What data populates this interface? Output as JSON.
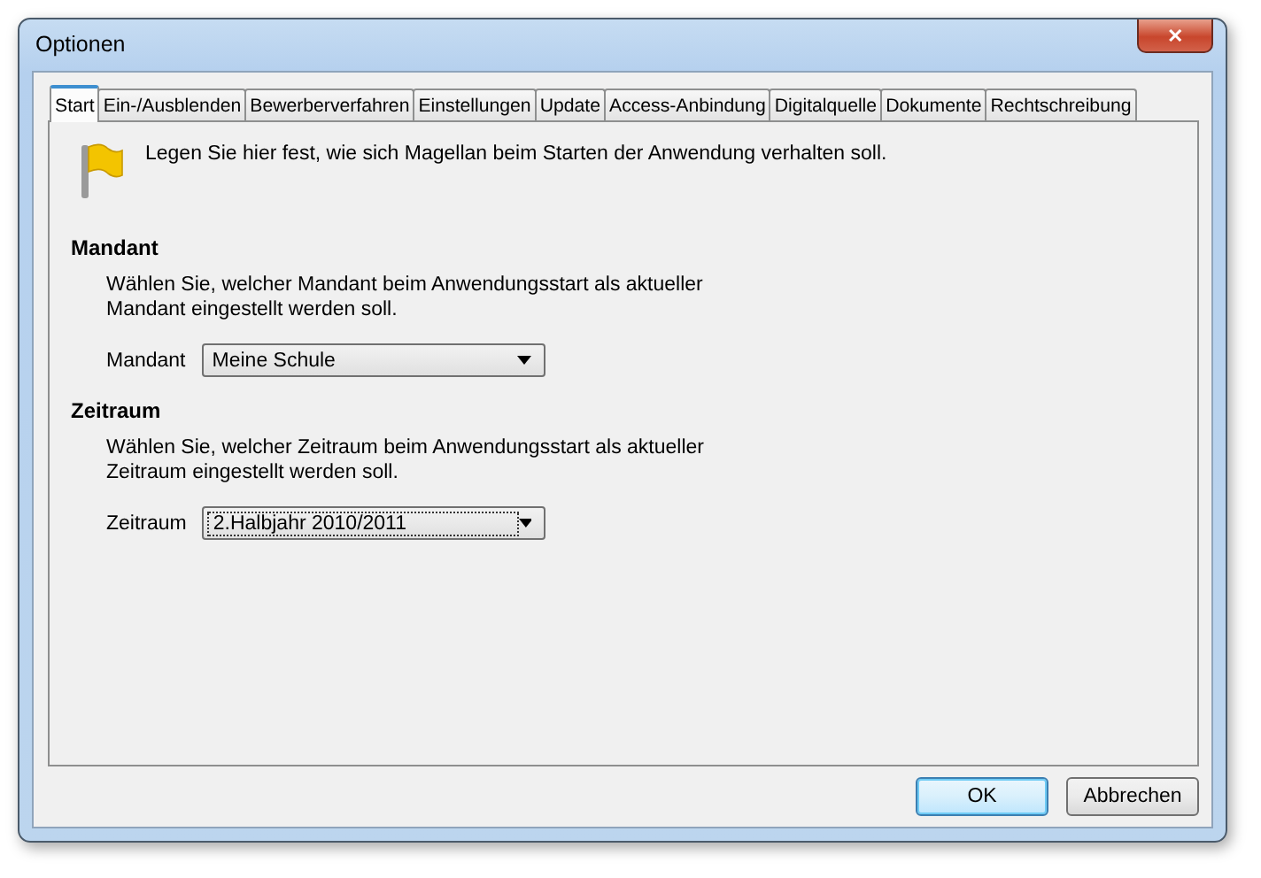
{
  "window": {
    "title": "Optionen",
    "close": "✕"
  },
  "tabs": [
    {
      "label": "Start",
      "selected": true
    },
    {
      "label": "Ein-/Ausblenden",
      "selected": false
    },
    {
      "label": "Bewerberverfahren",
      "selected": false
    },
    {
      "label": "Einstellungen",
      "selected": false
    },
    {
      "label": "Update",
      "selected": false
    },
    {
      "label": "Access-Anbindung",
      "selected": false
    },
    {
      "label": "Digitalquelle",
      "selected": false
    },
    {
      "label": "Dokumente",
      "selected": false
    },
    {
      "label": "Rechtschreibung",
      "selected": false
    }
  ],
  "intro": "Legen Sie hier fest, wie sich Magellan beim Starten der Anwendung verhalten soll.",
  "sections": [
    {
      "heading": "Mandant",
      "description": "Wählen Sie, welcher Mandant beim Anwendungsstart als aktueller Mandant eingestellt werden soll.",
      "field_label": "Mandant",
      "value": "Meine Schule",
      "focused": false
    },
    {
      "heading": "Zeitraum",
      "description": "Wählen Sie, welcher Zeitraum beim Anwendungsstart als aktueller Zeitraum eingestellt werden soll.",
      "field_label": "Zeitraum",
      "value": "2.Halbjahr 2010/2011",
      "focused": true
    }
  ],
  "buttons": [
    {
      "label": "OK",
      "default": true
    },
    {
      "label": "Abbrechen",
      "default": false
    }
  ]
}
